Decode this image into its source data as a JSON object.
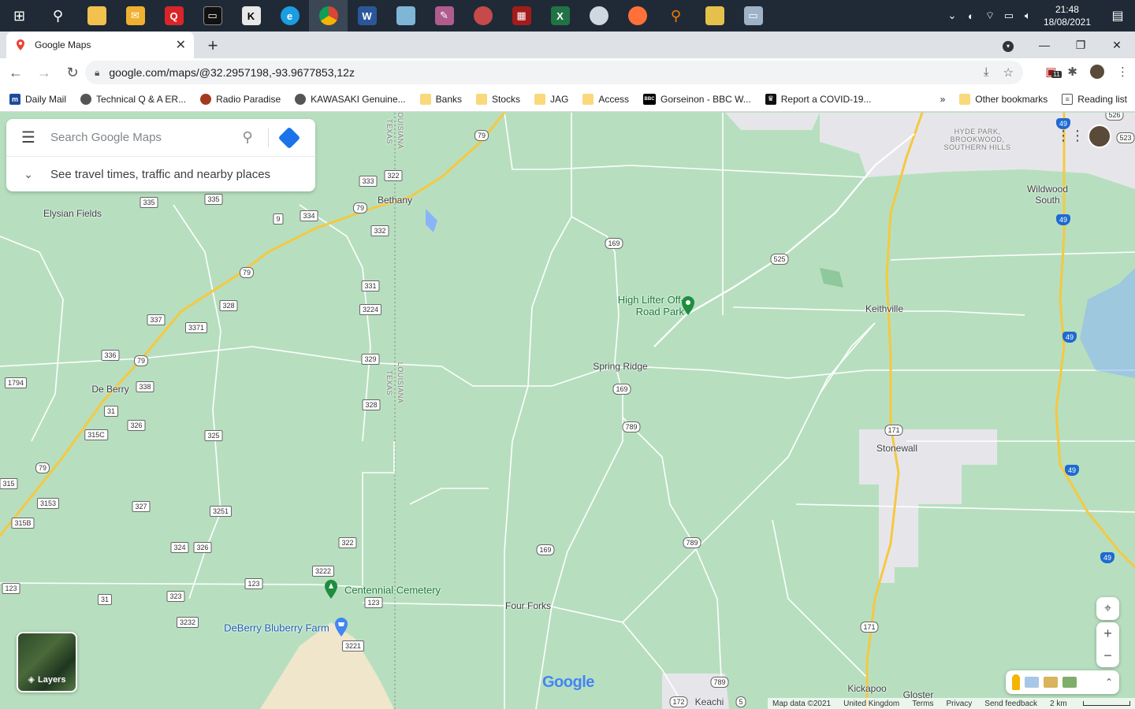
{
  "taskbar": {
    "icons": [
      "windows-start",
      "search",
      "file-explorer",
      "mail",
      "q-app",
      "terminal",
      "app-k",
      "edge",
      "chrome",
      "word",
      "app-blue",
      "app-pen",
      "app-red",
      "calculator",
      "excel",
      "app-circle",
      "firefox",
      "app-search",
      "app-yellow",
      "app-monitor"
    ],
    "time": "21:48",
    "date": "18/08/2021"
  },
  "browser": {
    "tab_title": "Google Maps",
    "url": "google.com/maps/@32.2957198,-93.9677853,12z",
    "profile_badge": "11"
  },
  "bookmarks": {
    "items": [
      {
        "label": "Daily Mail",
        "icon": "m"
      },
      {
        "label": "Technical Q & A ER...",
        "icon": "globe"
      },
      {
        "label": "Radio Paradise",
        "icon": "rp"
      },
      {
        "label": "KAWASAKI Genuine...",
        "icon": "globe"
      },
      {
        "label": "Banks",
        "icon": "folder"
      },
      {
        "label": "Stocks",
        "icon": "folder"
      },
      {
        "label": "JAG",
        "icon": "folder"
      },
      {
        "label": "Access",
        "icon": "folder"
      },
      {
        "label": "Gorseinon - BBC W...",
        "icon": "bbc"
      },
      {
        "label": "Report a COVID-19...",
        "icon": "gov"
      }
    ],
    "more": "»",
    "other": "Other bookmarks",
    "reading_list": "Reading list"
  },
  "search": {
    "placeholder": "Search Google Maps",
    "travel_times": "See travel times, traffic and nearby places"
  },
  "map": {
    "places": [
      {
        "name": "Elysian Fields"
      },
      {
        "name": "Bethany"
      },
      {
        "name": "De Berry"
      },
      {
        "name": "Spring Ridge"
      },
      {
        "name": "Keithville"
      },
      {
        "name": "Wildwood South"
      },
      {
        "name": "Stonewall"
      },
      {
        "name": "Four Forks"
      },
      {
        "name": "Kickapoo"
      },
      {
        "name": "Gloster"
      },
      {
        "name": "Keachi"
      },
      {
        "name": "HYDE PARK,"
      },
      {
        "name": "BROOKWOOD,"
      },
      {
        "name": "SOUTHERN HILLS"
      }
    ],
    "pois": [
      {
        "name": "High Lifter Off-Road Park"
      },
      {
        "name": "Centennial Cemetery"
      },
      {
        "name": "DeBerry Bluberry Farm"
      }
    ],
    "border_labels": [
      "LOUISIANA",
      "TEXAS"
    ],
    "shields": [
      "79",
      "333",
      "322",
      "335",
      "334",
      "9",
      "332",
      "331",
      "3224",
      "328",
      "337",
      "3371",
      "336",
      "1794",
      "338",
      "31",
      "326",
      "315C",
      "325",
      "329",
      "315",
      "3153",
      "315B",
      "327",
      "3251",
      "324",
      "3222",
      "123",
      "323",
      "3232",
      "3221",
      "169",
      "525",
      "789",
      "49",
      "171",
      "172",
      "5",
      "526",
      "523"
    ]
  },
  "controls": {
    "layers_label": "Layers",
    "logo": "Google",
    "map_data": "Map data ©2021",
    "region": "United Kingdom",
    "terms": "Terms",
    "privacy": "Privacy",
    "feedback": "Send feedback",
    "scale": "2 km"
  }
}
